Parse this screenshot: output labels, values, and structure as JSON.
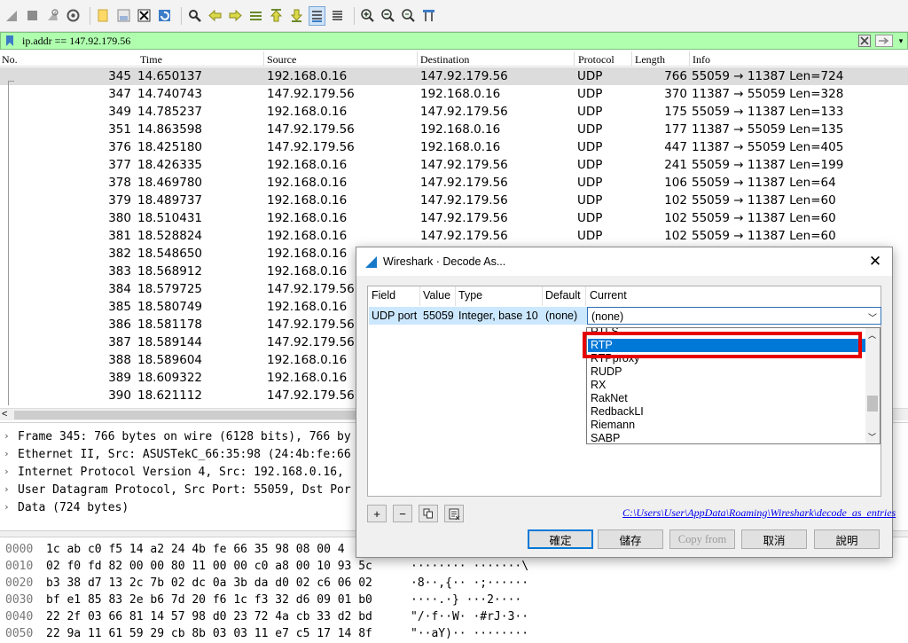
{
  "filter": {
    "value": "ip.addr == 147.92.179.56"
  },
  "packet_list": {
    "columns": [
      "No.",
      "Time",
      "Source",
      "Destination",
      "Protocol",
      "Length",
      "Info"
    ],
    "rows": [
      {
        "no": "345",
        "time": "14.650137",
        "src": "192.168.0.16",
        "dst": "147.92.179.56",
        "proto": "UDP",
        "len": "766",
        "info": "55059 → 11387 Len=724"
      },
      {
        "no": "347",
        "time": "14.740743",
        "src": "147.92.179.56",
        "dst": "192.168.0.16",
        "proto": "UDP",
        "len": "370",
        "info": "11387 → 55059 Len=328"
      },
      {
        "no": "349",
        "time": "14.785237",
        "src": "192.168.0.16",
        "dst": "147.92.179.56",
        "proto": "UDP",
        "len": "175",
        "info": "55059 → 11387 Len=133"
      },
      {
        "no": "351",
        "time": "14.863598",
        "src": "147.92.179.56",
        "dst": "192.168.0.16",
        "proto": "UDP",
        "len": "177",
        "info": "11387 → 55059 Len=135"
      },
      {
        "no": "376",
        "time": "18.425180",
        "src": "147.92.179.56",
        "dst": "192.168.0.16",
        "proto": "UDP",
        "len": "447",
        "info": "11387 → 55059 Len=405"
      },
      {
        "no": "377",
        "time": "18.426335",
        "src": "192.168.0.16",
        "dst": "147.92.179.56",
        "proto": "UDP",
        "len": "241",
        "info": "55059 → 11387 Len=199"
      },
      {
        "no": "378",
        "time": "18.469780",
        "src": "192.168.0.16",
        "dst": "147.92.179.56",
        "proto": "UDP",
        "len": "106",
        "info": "55059 → 11387 Len=64"
      },
      {
        "no": "379",
        "time": "18.489737",
        "src": "192.168.0.16",
        "dst": "147.92.179.56",
        "proto": "UDP",
        "len": "102",
        "info": "55059 → 11387 Len=60"
      },
      {
        "no": "380",
        "time": "18.510431",
        "src": "192.168.0.16",
        "dst": "147.92.179.56",
        "proto": "UDP",
        "len": "102",
        "info": "55059 → 11387 Len=60"
      },
      {
        "no": "381",
        "time": "18.528824",
        "src": "192.168.0.16",
        "dst": "147.92.179.56",
        "proto": "UDP",
        "len": "102",
        "info": "55059 → 11387 Len=60"
      },
      {
        "no": "382",
        "time": "18.548650",
        "src": "192.168.0.16",
        "dst": "",
        "proto": "",
        "len": "",
        "info": ""
      },
      {
        "no": "383",
        "time": "18.568912",
        "src": "192.168.0.16",
        "dst": "",
        "proto": "",
        "len": "",
        "info": ""
      },
      {
        "no": "384",
        "time": "18.579725",
        "src": "147.92.179.56",
        "dst": "",
        "proto": "",
        "len": "",
        "info": ""
      },
      {
        "no": "385",
        "time": "18.580749",
        "src": "192.168.0.16",
        "dst": "",
        "proto": "",
        "len": "",
        "info": ""
      },
      {
        "no": "386",
        "time": "18.581178",
        "src": "147.92.179.56",
        "dst": "",
        "proto": "",
        "len": "",
        "info": ""
      },
      {
        "no": "387",
        "time": "18.589144",
        "src": "147.92.179.56",
        "dst": "",
        "proto": "",
        "len": "",
        "info": ""
      },
      {
        "no": "388",
        "time": "18.589604",
        "src": "192.168.0.16",
        "dst": "",
        "proto": "",
        "len": "",
        "info": ""
      },
      {
        "no": "389",
        "time": "18.609322",
        "src": "192.168.0.16",
        "dst": "",
        "proto": "",
        "len": "",
        "info": ""
      },
      {
        "no": "390",
        "time": "18.621112",
        "src": "147.92.179.56",
        "dst": "",
        "proto": "",
        "len": "",
        "info": ""
      }
    ]
  },
  "details": [
    "Frame 345: 766 bytes on wire (6128 bits), 766 by",
    "Ethernet II, Src: ASUSTekC_66:35:98 (24:4b:fe:66",
    "Internet Protocol Version 4, Src: 192.168.0.16,",
    "User Datagram Protocol, Src Port: 55059, Dst Por",
    "Data (724 bytes)"
  ],
  "bytes": [
    {
      "off": "0000",
      "hex": "1c ab c0 f5 14 a2 24 4b  fe 66 35 98 08 00 4",
      "ascii": ""
    },
    {
      "off": "0010",
      "hex": "02 f0 fd 82 00 00 80 11  00 00 c0 a8 00 10 93 5c",
      "ascii": "········ ·······\\"
    },
    {
      "off": "0020",
      "hex": "b3 38 d7 13 2c 7b 02 dc  0a 3b da d0 02 c6 06 02",
      "ascii": "·8··,{·· ·;······"
    },
    {
      "off": "0030",
      "hex": "bf e1 85 83 2e b6 7d 20  f6 1c f3 32 d6 09 01 b0",
      "ascii": "····.·} ···2····"
    },
    {
      "off": "0040",
      "hex": "22 2f 03 66 81 14 57 98  d0 23 72 4a cb 33 d2 bd",
      "ascii": "\"/·f··W· ·#rJ·3··"
    },
    {
      "off": "0050",
      "hex": "22 9a 11 61 59 29 cb 8b  03 03 11 e7 c5 17 14 8f",
      "ascii": "\"··aY)·· ········"
    }
  ],
  "dialog": {
    "title": "Wireshark · Decode As...",
    "columns": [
      "Field",
      "Value",
      "Type",
      "Default",
      "Current"
    ],
    "row": {
      "field": "UDP port",
      "value": "55059",
      "type": "Integer, base 10",
      "default": "(none)",
      "current": "(none)"
    },
    "options": [
      "RTLS",
      "RTP",
      "RTPproxy",
      "RUDP",
      "RX",
      "RakNet",
      "RedbackLI",
      "Riemann",
      "SABP"
    ],
    "selected_option": "RTP",
    "path_link": "C:\\Users\\User\\AppData\\Roaming\\Wireshark\\decode_as_entries",
    "buttons": {
      "ok": "確定",
      "save": "儲存",
      "copy_from": "Copy from",
      "cancel": "取消",
      "help": "說明"
    },
    "add_symbol": "+",
    "remove_symbol": "−"
  },
  "colors": {
    "filter_ok_bg": "#afffaf",
    "selection_blue": "#0078d7",
    "highlight_red": "#e60000"
  }
}
